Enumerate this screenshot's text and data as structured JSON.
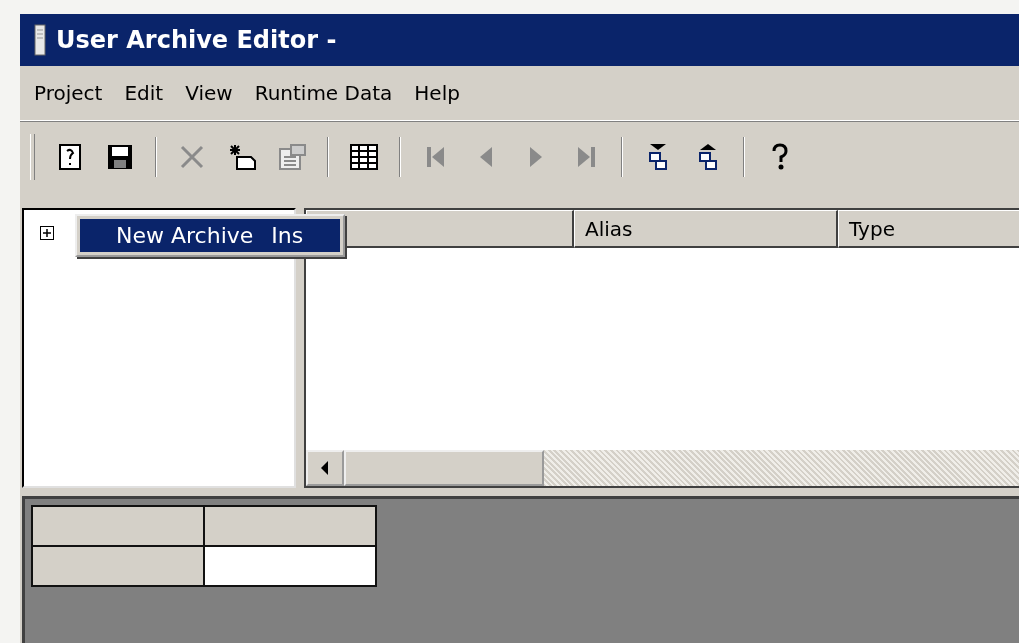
{
  "window": {
    "title": "User Archive Editor -"
  },
  "menu_bar": [
    {
      "label": "Project"
    },
    {
      "label": "Edit"
    },
    {
      "label": "View"
    },
    {
      "label": "Runtime Data"
    },
    {
      "label": "Help"
    }
  ],
  "toolbar": [
    {
      "kind": "button",
      "disabled": false
    },
    {
      "kind": "button",
      "disabled": false
    },
    {
      "kind": "separator"
    },
    {
      "kind": "button",
      "disabled": true
    },
    {
      "kind": "button",
      "disabled": false
    },
    {
      "kind": "button",
      "disabled": true
    },
    {
      "kind": "separator"
    },
    {
      "kind": "button",
      "disabled": false
    },
    {
      "kind": "separator"
    },
    {
      "kind": "button",
      "disabled": true
    },
    {
      "kind": "button",
      "disabled": true
    },
    {
      "kind": "button",
      "disabled": true
    },
    {
      "kind": "button",
      "disabled": true
    },
    {
      "kind": "separator"
    },
    {
      "kind": "button",
      "disabled": false
    },
    {
      "kind": "button",
      "disabled": false
    },
    {
      "kind": "separator"
    },
    {
      "kind": "button",
      "disabled": false
    }
  ],
  "tree": {
    "expanded": false
  },
  "table": {
    "columns": [
      {
        "label": "Alias"
      },
      {
        "label": "Type"
      }
    ]
  },
  "context_menu": {
    "items": [
      {
        "label": "New Archive",
        "shortcut": "Ins",
        "selected": true
      }
    ]
  }
}
